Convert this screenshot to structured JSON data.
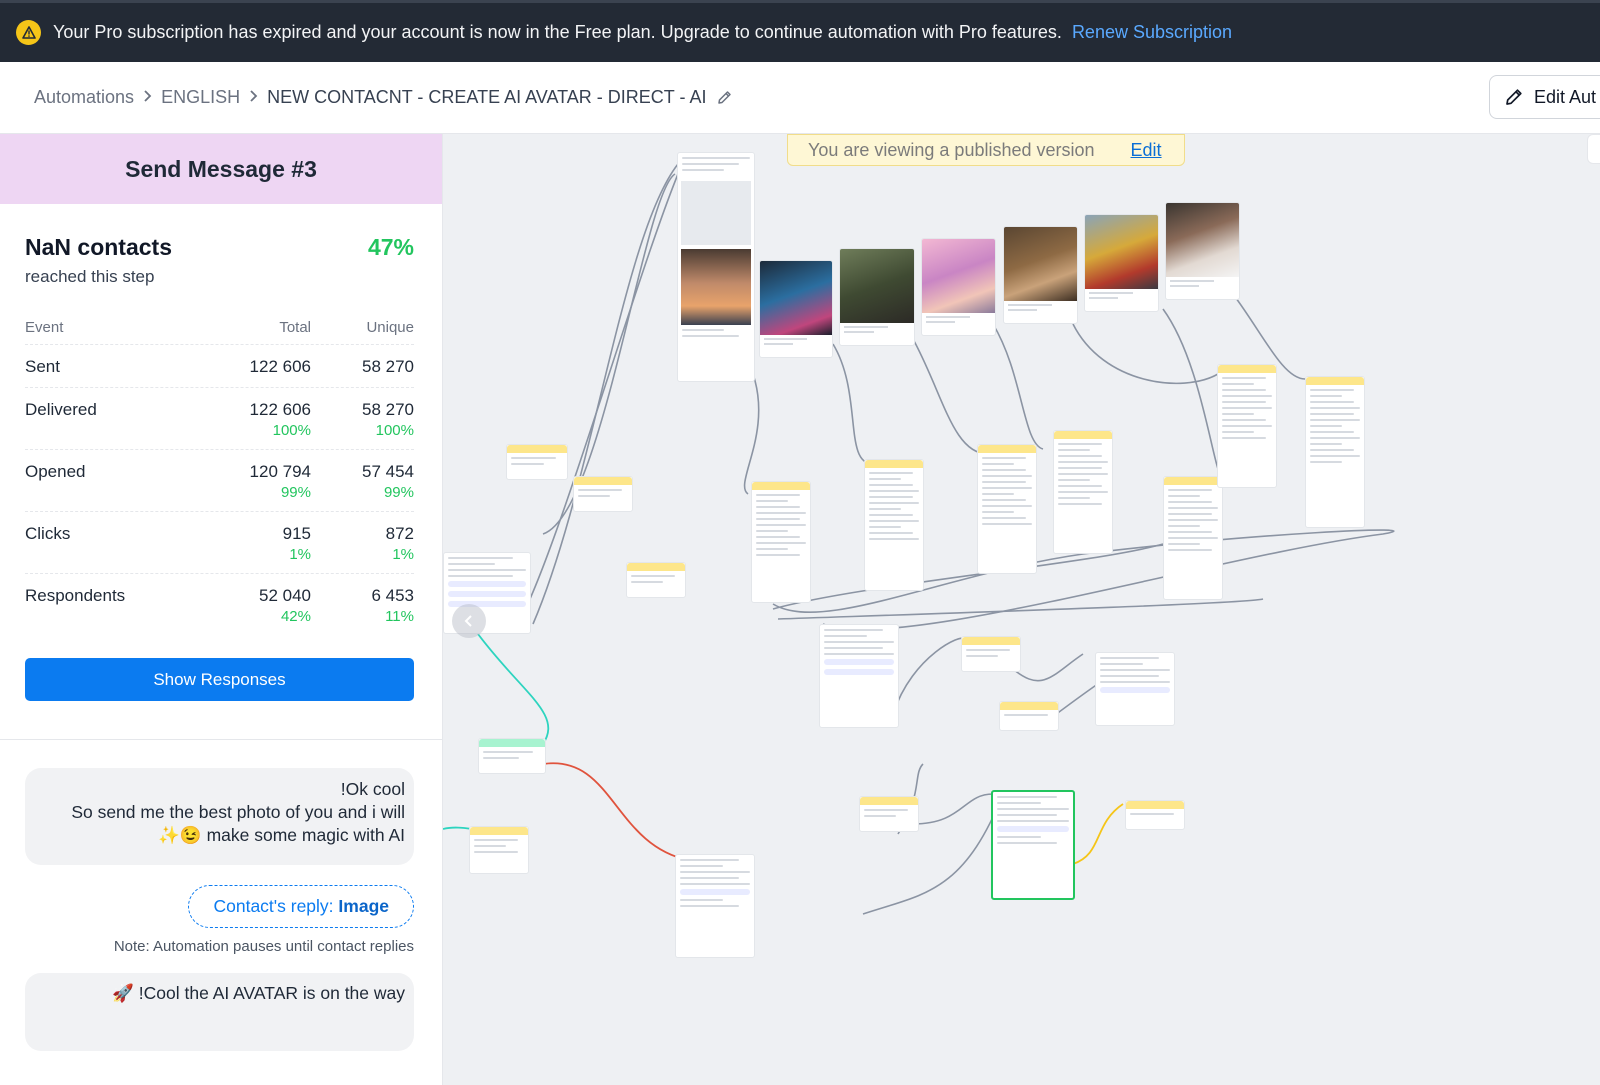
{
  "banner": {
    "message": "Your Pro subscription has expired and your account is now in the Free plan. Upgrade to continue automation with Pro features.",
    "link_label": "Renew Subscription",
    "icon": "warning-icon"
  },
  "breadcrumb": {
    "items": [
      "Automations",
      "ENGLISH"
    ],
    "current": "NEW CONTACNT - CREATE AI AVATAR - DIRECT - AI",
    "separator": ">"
  },
  "header": {
    "edit_button_label": "Edit Aut"
  },
  "panel": {
    "title": "Send Message #3",
    "contacts": "NaN contacts",
    "contacts_sub": "reached this step",
    "reach_pct": "47%",
    "table": {
      "headers": [
        "Event",
        "Total",
        "Unique"
      ],
      "rows": [
        {
          "event": "Sent",
          "total": "122 606",
          "unique": "58 270",
          "total_pct": "",
          "unique_pct": ""
        },
        {
          "event": "Delivered",
          "total": "122 606",
          "unique": "58 270",
          "total_pct": "100%",
          "unique_pct": "100%"
        },
        {
          "event": "Opened",
          "total": "120 794",
          "unique": "57 454",
          "total_pct": "99%",
          "unique_pct": "99%"
        },
        {
          "event": "Clicks",
          "total": "915",
          "unique": "872",
          "total_pct": "1%",
          "unique_pct": "1%"
        },
        {
          "event": "Respondents",
          "total": "52 040",
          "unique": "6 453",
          "total_pct": "42%",
          "unique_pct": "11%"
        }
      ]
    },
    "show_responses_label": "Show Responses",
    "message_lines": [
      "!Ok cool",
      "So send me the best photo of you and i will",
      "✨😉 make some magic with AI"
    ],
    "reply_prefix": "Contact's reply:",
    "reply_type": "Image",
    "note": "Note: Automation pauses until contact replies",
    "message2": "🚀 !Cool the AI AVATAR is on the way"
  },
  "canvas": {
    "published_text": "You are viewing a published version",
    "published_link": "Edit"
  },
  "colors": {
    "banner_bg": "#232a35",
    "link_blue": "#5aa9ff",
    "title_bg": "#eed6f3",
    "green": "#22c55e",
    "button_blue": "#0b7bf0"
  }
}
